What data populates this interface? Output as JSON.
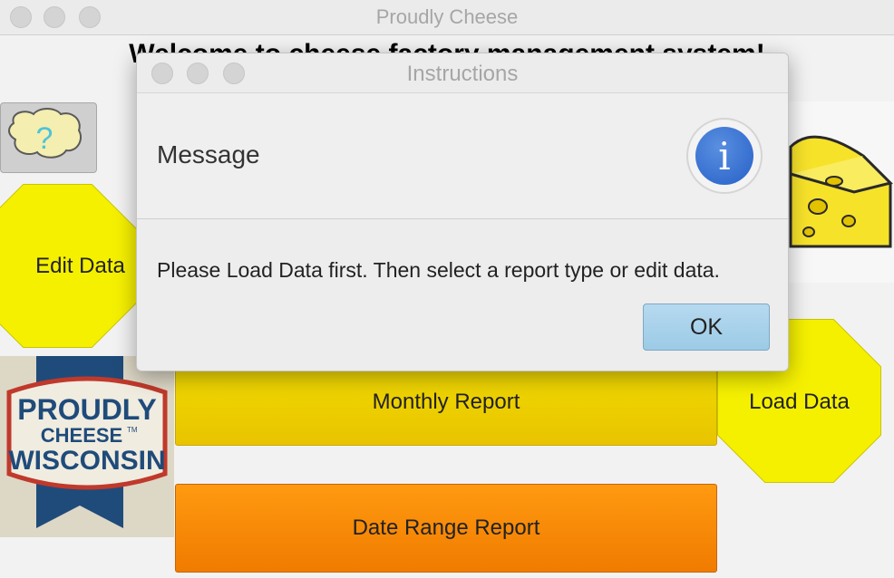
{
  "window": {
    "title": "Proudly Cheese",
    "welcome": "Welcome to cheese factory management system!"
  },
  "buttons": {
    "edit_data": "Edit Data",
    "load_data": "Load Data",
    "monthly_report": "Monthly Report",
    "date_range_report": "Date Range Report",
    "help_icon_glyph": "?"
  },
  "logo": {
    "line1": "PROUDLY",
    "line2": "CHEESE",
    "tm": "TM",
    "line3": "WISCONSIN"
  },
  "dialog": {
    "title": "Instructions",
    "header": "Message",
    "message": "Please Load Data first. Then select a report type or edit data.",
    "ok_label": "OK",
    "icon_glyph": "i"
  },
  "colors": {
    "octagon_yellow": "#f5f000",
    "monthly_yellow": "#f2dc00",
    "daterange_orange": "#ff9a10",
    "info_blue": "#2f6ad0",
    "ok_blue": "#a8d2eb"
  },
  "icons": [
    "close-icon",
    "minimize-icon",
    "zoom-icon",
    "help-cheese-icon",
    "info-icon",
    "cheese-image",
    "proudly-wisconsin-cheese-logo"
  ]
}
